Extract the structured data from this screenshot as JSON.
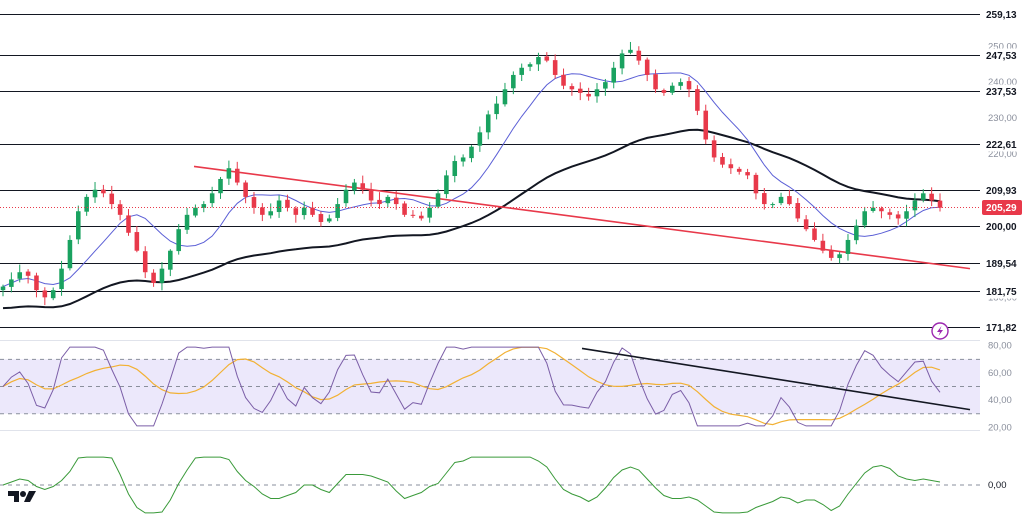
{
  "chart_data": {
    "type": "candlestick",
    "price_panel": {
      "y_ticks": [
        {
          "value": 180.0,
          "label": "180,00"
        },
        {
          "value": 190.0,
          "label": "190,00"
        },
        {
          "value": 200.0,
          "label": "200,00"
        },
        {
          "value": 210.0,
          "label": "210,00"
        },
        {
          "value": 220.0,
          "label": "220,00"
        },
        {
          "value": 230.0,
          "label": "230,00"
        },
        {
          "value": 240.0,
          "label": "240,00"
        },
        {
          "value": 250.0,
          "label": "250,00"
        }
      ],
      "levels": [
        {
          "value": 259.13,
          "label": "259,13"
        },
        {
          "value": 247.53,
          "label": "247,53"
        },
        {
          "value": 237.53,
          "label": "237,53"
        },
        {
          "value": 222.61,
          "label": "222,61"
        },
        {
          "value": 209.93,
          "label": "209,93"
        },
        {
          "value": 200.0,
          "label": "200,00"
        },
        {
          "value": 189.54,
          "label": "189,54"
        },
        {
          "value": 181.75,
          "label": "181,75"
        },
        {
          "value": 171.82,
          "label": "171,82"
        }
      ],
      "last_price": {
        "value": 205.29,
        "label": "205,29"
      },
      "trendline": {
        "start": [
          0.2,
          216.5
        ],
        "end": [
          1.0,
          188.0
        ],
        "color": "#e8394a"
      },
      "close": [
        183,
        185,
        187,
        186,
        182,
        180,
        182,
        188,
        196,
        204,
        208,
        210,
        209,
        206,
        203,
        198,
        193,
        187,
        184,
        188,
        193,
        199,
        203,
        205,
        206,
        209,
        213,
        216,
        212,
        208,
        205,
        203,
        204,
        207,
        205,
        203,
        205,
        203,
        201,
        202,
        206,
        210,
        212,
        210,
        207,
        206,
        208,
        206,
        203,
        203,
        202,
        205,
        209,
        214,
        218,
        219,
        222,
        226,
        231,
        234,
        238,
        242,
        244,
        245,
        247,
        246,
        242,
        239,
        238,
        237,
        236,
        238,
        240,
        244,
        248,
        249,
        246,
        242,
        238,
        237,
        239,
        240,
        238,
        232,
        224,
        219,
        217,
        216,
        215,
        214,
        209,
        206,
        206,
        208,
        206,
        202,
        199,
        196,
        193,
        191,
        192,
        196,
        200,
        204,
        205,
        204,
        203,
        202,
        204,
        207,
        209,
        207,
        205
      ],
      "ma_short": {
        "color": "#5b5fd6"
      },
      "ma_long": {
        "color": "#131722"
      }
    },
    "rsi_panel": {
      "y_ticks": [
        {
          "value": 20,
          "label": "20,00"
        },
        {
          "value": 40,
          "label": "40,00"
        },
        {
          "value": 60,
          "label": "60,00"
        },
        {
          "value": 80,
          "label": "80,00"
        }
      ],
      "band": [
        30,
        70
      ],
      "rsi_color": "#7b5ea7",
      "signal_color": "#f2b134",
      "trendline": {
        "start": [
          0.6,
          78
        ],
        "end": [
          1.0,
          33
        ],
        "color": "#131722"
      }
    },
    "momentum_panel": {
      "y_ticks": [
        {
          "value": 0,
          "label": "0,00"
        }
      ],
      "line_color": "#3a9a3a"
    },
    "colors": {
      "up": "#1aa260",
      "down": "#e8394a",
      "level_line": "#131722",
      "last_price_bg": "#e8394a",
      "rsi_band_fill": "#ece8fb"
    }
  },
  "logo": {
    "text": "TV"
  }
}
